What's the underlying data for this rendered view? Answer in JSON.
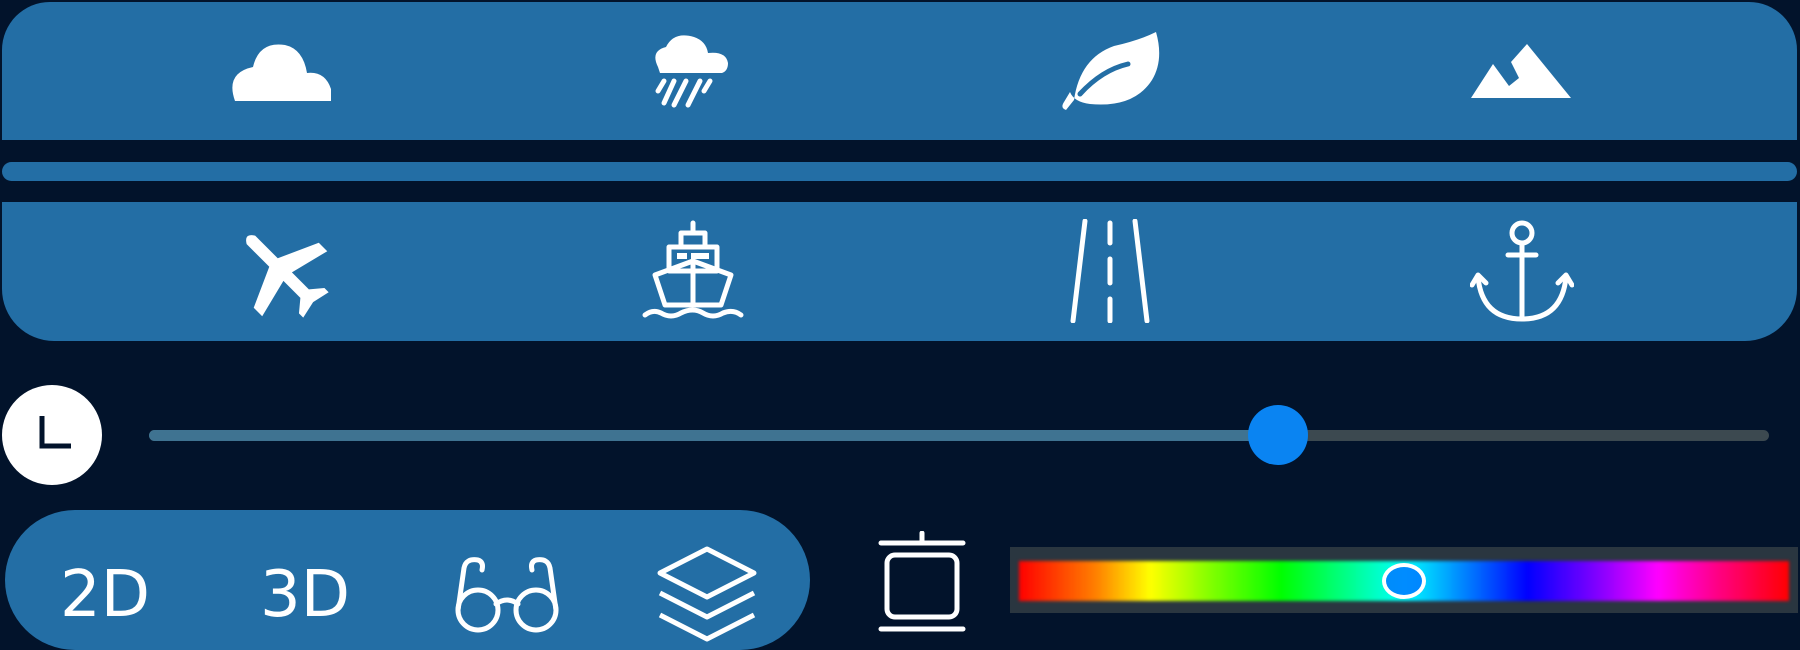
{
  "colors": {
    "background": "#02132b",
    "panel": "#236ea5",
    "accent": "#0a84f2",
    "track_filled": "#3f7391",
    "track_empty": "#3c4950"
  },
  "weather_layers": [
    {
      "icon": "cloud-icon"
    },
    {
      "icon": "rain-cloud-icon"
    },
    {
      "icon": "leaf-icon"
    },
    {
      "icon": "mountain-icon"
    }
  ],
  "transport_layers": [
    {
      "icon": "airplane-icon"
    },
    {
      "icon": "ship-icon"
    },
    {
      "icon": "road-icon"
    },
    {
      "icon": "anchor-icon"
    }
  ],
  "time_slider": {
    "icon": "clock-icon",
    "value": 0.697
  },
  "view_modes": {
    "mode_2d": "2D",
    "mode_3d": "3D",
    "glasses_icon": "glasses-icon",
    "layers_icon": "layers-icon"
  },
  "frame_tool": {
    "icon": "frame-icon"
  },
  "color_picker": {
    "value": 0.497
  }
}
